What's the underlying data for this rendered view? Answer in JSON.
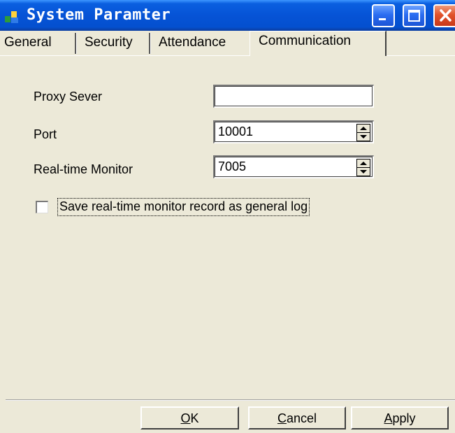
{
  "window": {
    "title": "System Paramter",
    "controls": [
      "minimize-icon",
      "maximize-icon",
      "close-icon"
    ]
  },
  "tabs": [
    {
      "label": "General",
      "active": false
    },
    {
      "label": "Security",
      "active": false
    },
    {
      "label": "Attendance",
      "active": false
    },
    {
      "label": "Communication",
      "active": true
    }
  ],
  "form": {
    "proxy_server": {
      "label": "Proxy Sever",
      "value": ""
    },
    "port": {
      "label": "Port",
      "value": "10001"
    },
    "realtime_monitor": {
      "label": "Real-time Monitor",
      "value": "7005"
    },
    "save_log": {
      "label": "Save real-time monitor record as general log",
      "checked": false
    }
  },
  "buttons": {
    "ok": {
      "mnemonic": "O",
      "rest": "K"
    },
    "cancel": {
      "mnemonic": "C",
      "rest": "ancel"
    },
    "apply": {
      "mnemonic": "A",
      "rest": "pply"
    }
  },
  "colors": {
    "titlebar": "#0653d6",
    "dialog_face": "#ece9d8",
    "close_button": "#e1532c"
  }
}
